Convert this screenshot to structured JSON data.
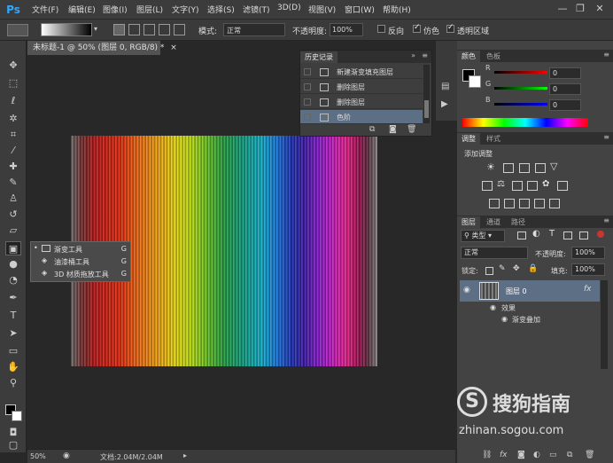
{
  "app": {
    "logo": "Ps"
  },
  "menu": [
    "文件(F)",
    "编辑(E)",
    "图像(I)",
    "图层(L)",
    "文字(Y)",
    "选择(S)",
    "滤镜(T)",
    "3D(D)",
    "视图(V)",
    "窗口(W)",
    "帮助(H)"
  ],
  "window_controls": {
    "minimize": "—",
    "restore": "❐",
    "close": "✕"
  },
  "options": {
    "mode_label": "模式:",
    "mode_value": "正常",
    "opacity_label": "不透明度:",
    "opacity_value": "100%",
    "reverse_label": "反向",
    "dither_label": "仿色",
    "transparency_label": "透明区域"
  },
  "document": {
    "tab_title": "未标题-1 @ 50% (图层 0, RGB/8) *",
    "close": "×"
  },
  "status": {
    "zoom": "50%",
    "doc_info": "文档:2.04M/2.04M"
  },
  "flyout": [
    {
      "label": "渐变工具",
      "key": "G"
    },
    {
      "label": "油漆桶工具",
      "key": "G"
    },
    {
      "label": "3D 材质拖放工具",
      "key": "G"
    }
  ],
  "history": {
    "title": "历史记录",
    "items": [
      "新建渐变填充图层",
      "删除图层",
      "删除图层",
      "色阶"
    ]
  },
  "color_panel": {
    "tabs": [
      "颜色",
      "色板"
    ],
    "channels": [
      {
        "name": "R",
        "value": "0"
      },
      {
        "name": "G",
        "value": "0"
      },
      {
        "name": "B",
        "value": "0"
      }
    ]
  },
  "adjust_panel": {
    "tabs": [
      "调整",
      "样式"
    ],
    "title": "添加调整"
  },
  "layers_panel": {
    "tabs": [
      "图层",
      "通道",
      "路径"
    ],
    "filter_value": "类型",
    "blend_value": "正常",
    "opacity_label": "不透明度:",
    "opacity_value": "100%",
    "lock_label": "锁定:",
    "fill_label": "填充:",
    "fill_value": "100%",
    "layer_name": "图层 0",
    "fx_label": "fx",
    "effects_label": "效果",
    "effect_item": "渐变叠加"
  },
  "watermark": {
    "brand": "搜狗指南",
    "url": "zhinan.sogou.com"
  },
  "colors": {
    "selection": "#5c6f85",
    "panel_bg": "#434343",
    "accent": "#31a8ff"
  }
}
